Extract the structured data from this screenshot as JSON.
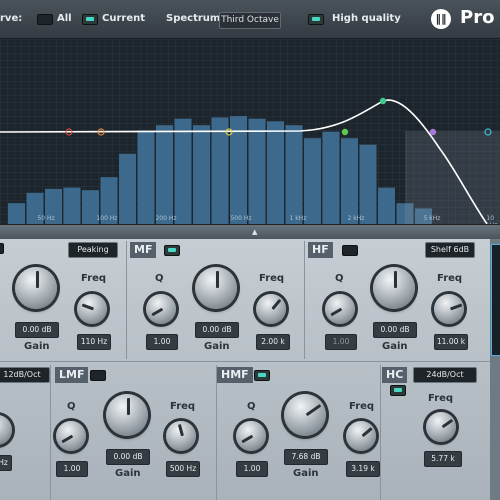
{
  "top_bar": {
    "curve_label": "rve:",
    "all_label": "All",
    "current_label": "Current",
    "spectrum_label": "Spectrum",
    "spectrum_value": "Third Octave",
    "high_quality_label": "High quality",
    "logo_text": "Pro"
  },
  "graph": {
    "freq_labels": [
      "50 Hz",
      "100 Hz",
      "200 Hz",
      "500 Hz",
      "1 kHz",
      "2 kHz",
      "5 kHz",
      "10 kHz"
    ],
    "spectrum_levels": [
      0.16,
      0.24,
      0.27,
      0.28,
      0.26,
      0.36,
      0.54,
      0.72,
      0.76,
      0.81,
      0.76,
      0.82,
      0.83,
      0.81,
      0.79,
      0.76,
      0.66,
      0.71,
      0.66,
      0.61,
      0.28,
      0.16,
      0.12
    ]
  },
  "bands": {
    "lf_type": "Peaking",
    "lf_gain_value": "0.00 dB",
    "lf_freq_value": "110 Hz",
    "mf_label": "MF",
    "mf_q_value": "1.00",
    "mf_gain_value": "0.00 dB",
    "mf_freq_value": "2.00 k",
    "hf_label": "HF",
    "hf_type": "Shelf 6dB",
    "hf_q_value": "1.00",
    "hf_gain_value": "0.00 dB",
    "hf_freq_value": "11.00 k",
    "lc_slope": "12dB/Oct",
    "lc_freq_value": "Hz",
    "lmf_label": "LMF",
    "lmf_q_value": "1.00",
    "lmf_gain_value": "0.00 dB",
    "lmf_freq_value": "500 Hz",
    "hmf_label": "HMF",
    "hmf_q_value": "1.00",
    "hmf_gain_value": "7.68 dB",
    "hmf_freq_value": "3.19 k",
    "hc_label": "HC",
    "hc_slope": "24dB/Oct",
    "hc_freq_value": "5.77 k"
  },
  "knob_labels": {
    "q": "Q",
    "gain": "Gain",
    "freq": "Freq"
  },
  "colors": {
    "bar": "#3d6a8c",
    "curve": "#ffffff",
    "lf": "#e2883a",
    "mf": "#5ec94c",
    "hf": "#3fbfd8",
    "lmf": "#e4cf3a",
    "hmf": "#3ec98f",
    "hc": "#a778d8",
    "led": "#49d8c6"
  }
}
